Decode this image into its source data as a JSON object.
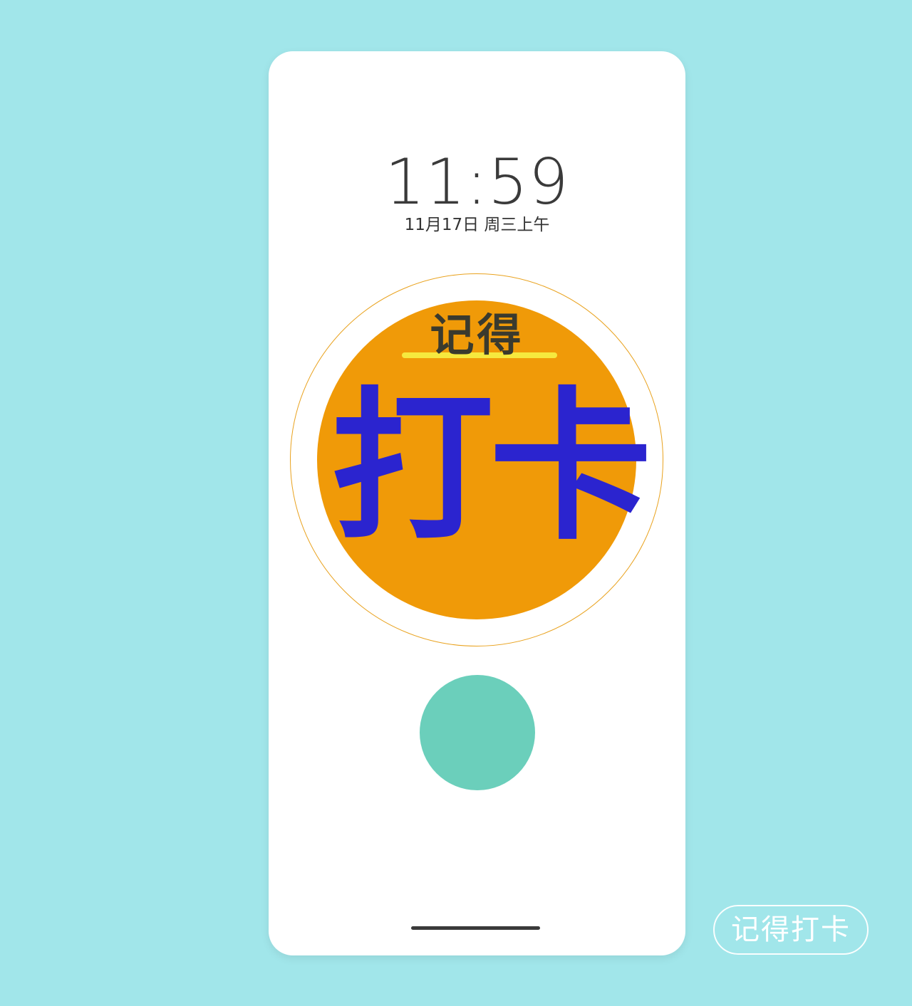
{
  "lockscreen": {
    "time": "11:59",
    "date": "11月17日 周三上午"
  },
  "poster": {
    "small_text": "记得",
    "big_text": "打卡"
  },
  "watermark": {
    "label": "记得打卡"
  },
  "colors": {
    "background": "#a1e6ea",
    "phone_screen": "#ffffff",
    "orange_disc": "#f09a08",
    "ring": "#e9a21e",
    "highlight_bar": "#f6e93e",
    "big_text": "#2b24cf",
    "teal_button": "#6bcfbb"
  }
}
